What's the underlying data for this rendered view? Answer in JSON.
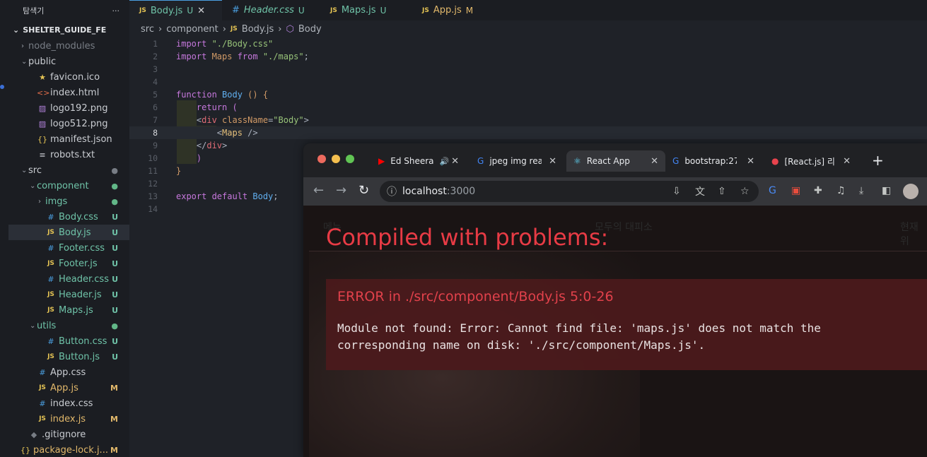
{
  "explorer": {
    "title": "탐색기",
    "more": "···",
    "project": "SHELTER_GUIDE_FE",
    "items": [
      {
        "label": "node_modules",
        "depth": 1,
        "chev": "›",
        "icon": "",
        "icon_class": "",
        "status": "",
        "status_class": "",
        "label_class": "dim",
        "active": false
      },
      {
        "label": "public",
        "depth": 1,
        "chev": "⌄",
        "icon": "",
        "icon_class": "",
        "status": "",
        "status_class": "",
        "label_class": "",
        "active": false
      },
      {
        "label": "favicon.ico",
        "depth": 2,
        "chev": "",
        "icon": "★",
        "icon_class": "c-star",
        "status": "",
        "status_class": "",
        "label_class": "",
        "active": false
      },
      {
        "label": "index.html",
        "depth": 2,
        "chev": "",
        "icon": "<>",
        "icon_class": "c-html",
        "status": "",
        "status_class": "",
        "label_class": "",
        "active": false
      },
      {
        "label": "logo192.png",
        "depth": 2,
        "chev": "",
        "icon": "▨",
        "icon_class": "c-img",
        "status": "",
        "status_class": "",
        "label_class": "",
        "active": false
      },
      {
        "label": "logo512.png",
        "depth": 2,
        "chev": "",
        "icon": "▨",
        "icon_class": "c-img",
        "status": "",
        "status_class": "",
        "label_class": "",
        "active": false
      },
      {
        "label": "manifest.json",
        "depth": 2,
        "chev": "",
        "icon": "{}",
        "icon_class": "c-json",
        "status": "",
        "status_class": "",
        "label_class": "",
        "active": false
      },
      {
        "label": "robots.txt",
        "depth": 2,
        "chev": "",
        "icon": "≡",
        "icon_class": "",
        "status": "",
        "status_class": "",
        "label_class": "",
        "active": false
      },
      {
        "label": "src",
        "depth": 1,
        "chev": "⌄",
        "icon": "",
        "icon_class": "",
        "status": "●",
        "status_class": "dim",
        "label_class": "",
        "active": false
      },
      {
        "label": "component",
        "depth": 2,
        "chev": "⌄",
        "icon": "",
        "icon_class": "",
        "status": "●",
        "status_class": "grn",
        "label_class": "u",
        "active": false
      },
      {
        "label": "imgs",
        "depth": 3,
        "chev": "›",
        "icon": "",
        "icon_class": "",
        "status": "●",
        "status_class": "grn",
        "label_class": "u",
        "active": false
      },
      {
        "label": "Body.css",
        "depth": 3,
        "chev": "",
        "icon": "#",
        "icon_class": "c-css",
        "status": "U",
        "status_class": "u",
        "label_class": "u",
        "active": false
      },
      {
        "label": "Body.js",
        "depth": 3,
        "chev": "",
        "icon": "JS",
        "icon_class": "c-js",
        "status": "U",
        "status_class": "u",
        "label_class": "u",
        "active": true
      },
      {
        "label": "Footer.css",
        "depth": 3,
        "chev": "",
        "icon": "#",
        "icon_class": "c-css",
        "status": "U",
        "status_class": "u",
        "label_class": "u",
        "active": false
      },
      {
        "label": "Footer.js",
        "depth": 3,
        "chev": "",
        "icon": "JS",
        "icon_class": "c-js",
        "status": "U",
        "status_class": "u",
        "label_class": "u",
        "active": false
      },
      {
        "label": "Header.css",
        "depth": 3,
        "chev": "",
        "icon": "#",
        "icon_class": "c-css",
        "status": "U",
        "status_class": "u",
        "label_class": "u",
        "active": false
      },
      {
        "label": "Header.js",
        "depth": 3,
        "chev": "",
        "icon": "JS",
        "icon_class": "c-js",
        "status": "U",
        "status_class": "u",
        "label_class": "u",
        "active": false
      },
      {
        "label": "Maps.js",
        "depth": 3,
        "chev": "",
        "icon": "JS",
        "icon_class": "c-js",
        "status": "U",
        "status_class": "u",
        "label_class": "u",
        "active": false
      },
      {
        "label": "utils",
        "depth": 2,
        "chev": "⌄",
        "icon": "",
        "icon_class": "",
        "status": "●",
        "status_class": "grn",
        "label_class": "u",
        "active": false
      },
      {
        "label": "Button.css",
        "depth": 3,
        "chev": "",
        "icon": "#",
        "icon_class": "c-css",
        "status": "U",
        "status_class": "u",
        "label_class": "u",
        "active": false
      },
      {
        "label": "Button.js",
        "depth": 3,
        "chev": "",
        "icon": "JS",
        "icon_class": "c-js",
        "status": "U",
        "status_class": "u",
        "label_class": "u",
        "active": false
      },
      {
        "label": "App.css",
        "depth": 2,
        "chev": "",
        "icon": "#",
        "icon_class": "c-css",
        "status": "",
        "status_class": "",
        "label_class": "",
        "active": false
      },
      {
        "label": "App.js",
        "depth": 2,
        "chev": "",
        "icon": "JS",
        "icon_class": "c-js",
        "status": "M",
        "status_class": "m",
        "label_class": "m",
        "active": false
      },
      {
        "label": "index.css",
        "depth": 2,
        "chev": "",
        "icon": "#",
        "icon_class": "c-css",
        "status": "",
        "status_class": "",
        "label_class": "",
        "active": false
      },
      {
        "label": "index.js",
        "depth": 2,
        "chev": "",
        "icon": "JS",
        "icon_class": "c-js",
        "status": "M",
        "status_class": "m",
        "label_class": "m",
        "active": false
      },
      {
        "label": ".gitignore",
        "depth": 1,
        "chev": "",
        "icon": "◆",
        "icon_class": "dim",
        "status": "",
        "status_class": "",
        "label_class": "",
        "active": false
      },
      {
        "label": "package-lock.j...",
        "depth": 0,
        "chev": "",
        "icon": "{}",
        "icon_class": "c-json",
        "status": "M",
        "status_class": "m",
        "label_class": "m",
        "active": false
      }
    ]
  },
  "editor_tabs": [
    {
      "badge": "JS",
      "label": "Body.js",
      "status": "U",
      "close": "✕",
      "active": true,
      "italic": false,
      "status_class": "u"
    },
    {
      "badge": "#",
      "label": "Header.css",
      "status": "U",
      "close": "",
      "active": false,
      "italic": true,
      "status_class": "u"
    },
    {
      "badge": "JS",
      "label": "Maps.js",
      "status": "U",
      "close": "",
      "active": false,
      "italic": false,
      "status_class": "u"
    },
    {
      "badge": "JS",
      "label": "App.js",
      "status": "M",
      "close": "",
      "active": false,
      "italic": false,
      "status_class": "m"
    }
  ],
  "breadcrumb": {
    "p1": "src",
    "p2": "component",
    "p3_badge": "JS",
    "p3": "Body.js",
    "p4": "Body"
  },
  "code_lines": [
    [
      {
        "t": "import ",
        "c": "kw"
      },
      {
        "t": "\"./Body.css\"",
        "c": "str"
      }
    ],
    [
      {
        "t": "import ",
        "c": "kw"
      },
      {
        "t": "Maps ",
        "c": "attr"
      },
      {
        "t": "from ",
        "c": "kw"
      },
      {
        "t": "\"./maps\"",
        "c": "str"
      },
      {
        "t": ";",
        "c": "plain"
      }
    ],
    [],
    [],
    [
      {
        "t": "function ",
        "c": "kw"
      },
      {
        "t": "Body ",
        "c": "fn"
      },
      {
        "t": "() {",
        "c": "attr"
      }
    ],
    [
      {
        "t": "    return ",
        "c": "kw"
      },
      {
        "t": "(",
        "c": "brk"
      }
    ],
    [
      {
        "t": "    <",
        "c": "plain"
      },
      {
        "t": "div ",
        "c": "tag"
      },
      {
        "t": "className",
        "c": "attr"
      },
      {
        "t": "=",
        "c": "plain"
      },
      {
        "t": "\"Body\"",
        "c": "str"
      },
      {
        "t": ">",
        "c": "plain"
      }
    ],
    [
      {
        "t": "        <",
        "c": "plain"
      },
      {
        "t": "Maps ",
        "c": "def"
      },
      {
        "t": "/>",
        "c": "plain"
      }
    ],
    [
      {
        "t": "    </",
        "c": "plain"
      },
      {
        "t": "div",
        "c": "tag"
      },
      {
        "t": ">",
        "c": "plain"
      }
    ],
    [
      {
        "t": "    )",
        "c": "brk"
      }
    ],
    [
      {
        "t": "}",
        "c": "attr"
      }
    ],
    [],
    [
      {
        "t": "export ",
        "c": "kw"
      },
      {
        "t": "default ",
        "c": "kw"
      },
      {
        "t": "Body",
        "c": "fn"
      },
      {
        "t": ";",
        "c": "plain"
      }
    ],
    []
  ],
  "current_line": 8,
  "browser": {
    "tabs": [
      {
        "label": "Ed Sheera",
        "icon": "youtube-icon",
        "extra": "🔊",
        "close": "✕",
        "active": false
      },
      {
        "label": "jpeg img reac",
        "icon": "google-icon",
        "extra": "",
        "close": "✕",
        "active": false
      },
      {
        "label": "React App",
        "icon": "react-icon",
        "extra": "",
        "close": "✕",
        "active": true
      },
      {
        "label": "bootstrap:27",
        "icon": "google-icon",
        "extra": "",
        "close": "✕",
        "active": false
      },
      {
        "label": "[React.js] 리",
        "icon": "velog-icon",
        "extra": "",
        "close": "✕",
        "active": false
      }
    ],
    "new_tab": "+",
    "url_host": "localhost",
    "url_port": ":3000",
    "page_nav": {
      "left": "메뉴",
      "center": "모두의 대피소",
      "right": "현재 위"
    },
    "overlay": {
      "title": "Compiled with problems:",
      "error_head": "ERROR in ./src/component/Body.js 5:0-26",
      "error_msg": "Module not found: Error: Cannot find file: 'maps.js' does not match the\ncorresponding name on disk: './src/component/Maps.js'."
    }
  },
  "colors": {
    "accent": "#4a9fe0",
    "error": "#e83b45",
    "untracked": "#6fc3a8",
    "modified": "#e2b86b"
  }
}
